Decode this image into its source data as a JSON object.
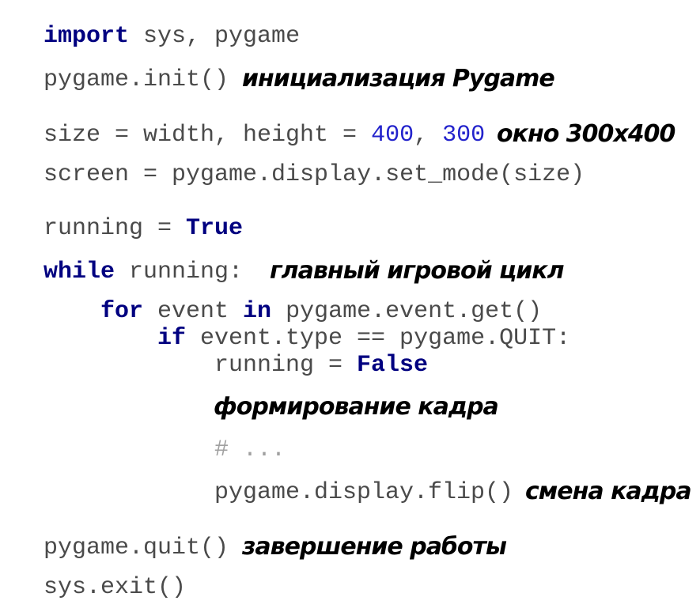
{
  "code": {
    "l1": {
      "kw": "import",
      "rest": " sys, pygame"
    },
    "l2": {
      "text": "pygame.init()"
    },
    "l3": {
      "pre": "size = width, height = ",
      "n1": "400",
      "mid": ", ",
      "n2": "300"
    },
    "l4": {
      "text": "screen = pygame.display.set_mode(size)"
    },
    "l5": {
      "pre": "running = ",
      "kw": "True"
    },
    "l6": {
      "kw": "while",
      "rest": " running:"
    },
    "l7": {
      "kw1": "for",
      "mid": " event ",
      "kw2": "in",
      "rest": " pygame.event.get()"
    },
    "l8": {
      "kw": "if",
      "rest": " event.type == pygame.QUIT:"
    },
    "l9": {
      "pre": "running = ",
      "kw": "False"
    },
    "l10": {
      "text": "# ..."
    },
    "l11": {
      "text": "pygame.display.flip()"
    },
    "l12": {
      "text": "pygame.quit()"
    },
    "l13": {
      "text": "sys.exit()"
    }
  },
  "notes": {
    "init": "инициализация Pygame",
    "window": "окно 300x400",
    "loop": "главный игровой цикл",
    "frame": "формирование кадра",
    "flip": "смена кадра",
    "quit": "завершение работы"
  },
  "colors": {
    "keyword": "#000080",
    "number": "#2323cc",
    "code": "#4a4a4a",
    "comment": "#a0a0a0",
    "annotation": "#000000",
    "background": "#ffffff"
  }
}
